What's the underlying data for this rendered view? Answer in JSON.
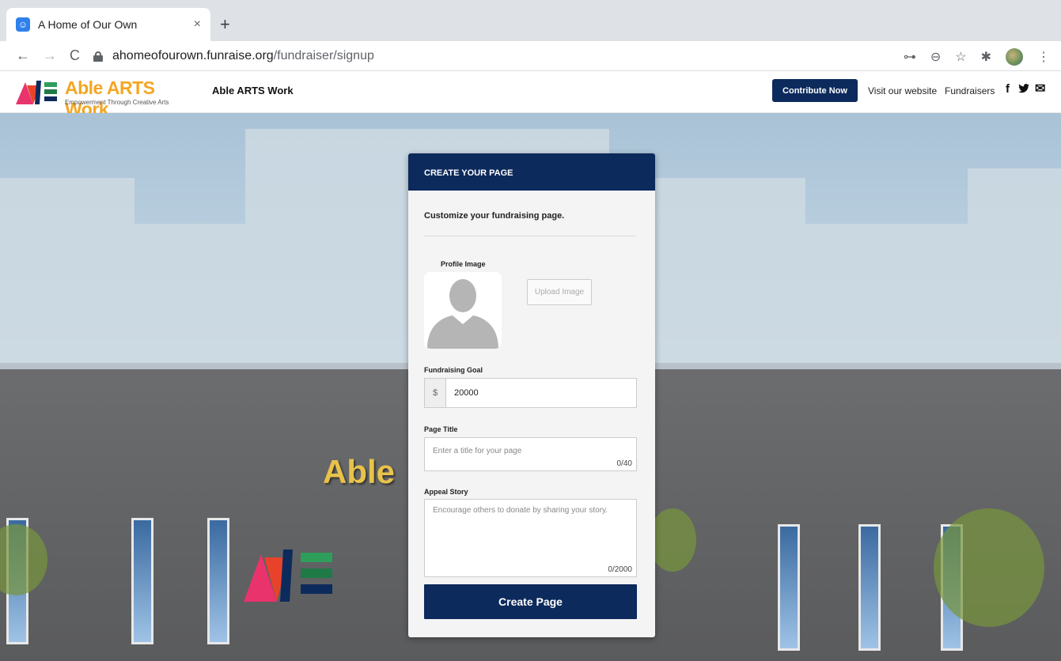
{
  "browser": {
    "tab_title": "A Home of Our Own",
    "tab_close": "×",
    "new_tab": "+",
    "url_host": "ahomeofourown.funraise.org",
    "url_path": "/fundraiser/signup",
    "nav": {
      "back": "←",
      "forward": "→",
      "reload": "C"
    },
    "toolbar_icons": {
      "key": "⊶",
      "zoom": "⊖",
      "star": "☆",
      "extensions": "✱",
      "menu": "⋮"
    }
  },
  "site": {
    "logo_text": "Able ARTS Work",
    "logo_tagline": "Empowerment Through Creative Arts",
    "name": "Able ARTS Work",
    "contribute_label": "Contribute Now",
    "links": [
      "Visit our website",
      "Fundraisers"
    ],
    "social": {
      "facebook": "f",
      "twitter": "t",
      "email": "✉"
    }
  },
  "background": {
    "sign_text": "Able"
  },
  "form": {
    "header": "CREATE YOUR PAGE",
    "subtitle": "Customize your fundraising page.",
    "profile_label": "Profile Image",
    "upload_label": "Upload Image",
    "goal_label": "Fundraising Goal",
    "goal_prefix": "$",
    "goal_value": "20000",
    "title_label": "Page Title",
    "title_placeholder": "Enter a title for your page",
    "title_counter": "0/40",
    "story_label": "Appeal Story",
    "story_placeholder": "Encourage others to donate by sharing your story.",
    "story_counter": "0/2000",
    "submit_label": "Create Page"
  },
  "colors": {
    "navy": "#0d2a5c",
    "logo_orange": "#f5a623"
  }
}
